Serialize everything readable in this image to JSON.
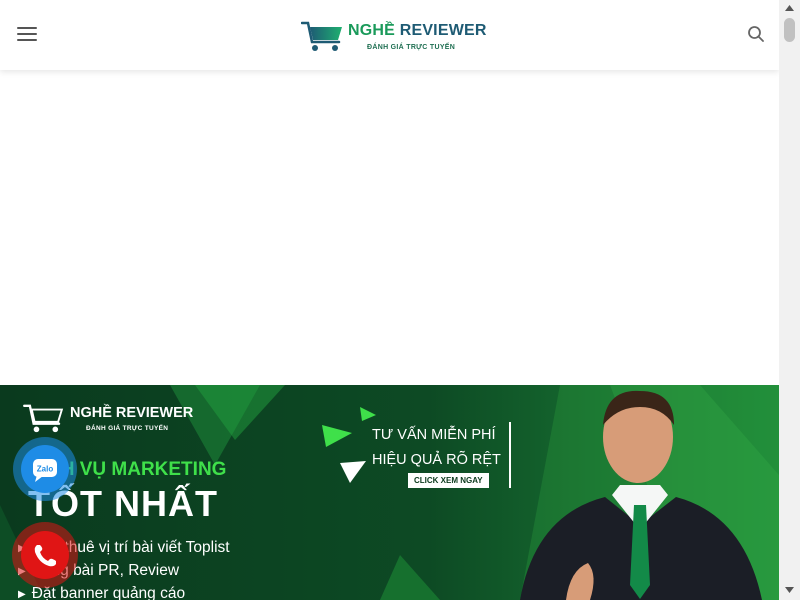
{
  "header": {
    "logo_title_part1": "NGHỀ",
    "logo_title_part2": "REVIEWER",
    "logo_subtitle": "ĐÁNH GIÁ TRỰC TUYẾN"
  },
  "banner": {
    "logo_title": "NGHỀ REVIEWER",
    "logo_subtitle": "ĐÁNH GIÁ TRỰC TUYẾN",
    "service_title": "DỊCH VỤ MARKETING",
    "best": "TỐT NHẤT",
    "items": [
      "Cho thuê vị trí bài viết Toplist",
      "Đăng bài PR, Review",
      "Đặt banner quảng cáo"
    ],
    "consult_line1": "TƯ VẤN MIỄN PHÍ",
    "consult_line2": "HIỆU QUẢ RÕ RỆT",
    "cta": "CLICK XEM NGAY"
  },
  "float": {
    "zalo_label": "Zalo"
  },
  "colors": {
    "brand_green": "#1a9a5a",
    "brand_teal": "#1e5b74",
    "banner_dark": "#0b3a1d",
    "accent_green": "#3fe04a",
    "zalo_blue": "#1e8ce6",
    "phone_red": "#e01515"
  },
  "icons": {
    "menu": "hamburger-menu-icon",
    "search": "search-icon",
    "logo": "shopping-cart-icon",
    "zalo": "zalo-chat-icon",
    "phone": "phone-icon"
  }
}
